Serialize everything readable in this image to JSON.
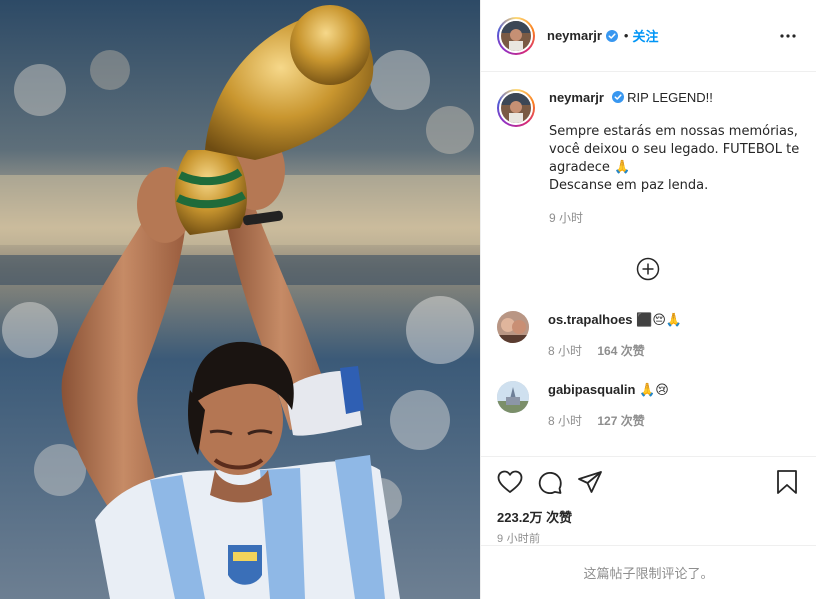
{
  "post": {
    "author": {
      "username": "neymarjr",
      "follow_label": "关注",
      "separator": "•"
    },
    "caption": {
      "username": "neymarjr",
      "headline": "RIP LEGEND!!",
      "text": "Sempre estarás em nossas memórias,\nvocê deixou o seu legado. FUTEBOL te\nagradece 🙏\nDescanse em paz lenda.",
      "time": "9 小时"
    },
    "comments": [
      {
        "username": "os.trapalhoes",
        "text": "⬛😔🙏",
        "time": "8 小时",
        "likes": "164 次赞"
      },
      {
        "username": "gabipasqualin",
        "text": "🙏😢",
        "time": "8 小时",
        "likes": "127 次赞"
      }
    ],
    "likes_label": "223.2万 次赞",
    "posted_time": "9 小时前",
    "comments_disabled_text": "这篇帖子限制评论了。",
    "icons": {
      "more": "more-options-icon",
      "load_more": "plus-circle-icon",
      "like": "heart-icon",
      "comment": "comment-icon",
      "share": "paper-plane-icon",
      "save": "bookmark-icon",
      "verified": "verified-badge-icon"
    },
    "colors": {
      "accent": "#0095f6",
      "text": "#262626",
      "secondary": "#8e8e8e",
      "border": "#efefef"
    }
  }
}
